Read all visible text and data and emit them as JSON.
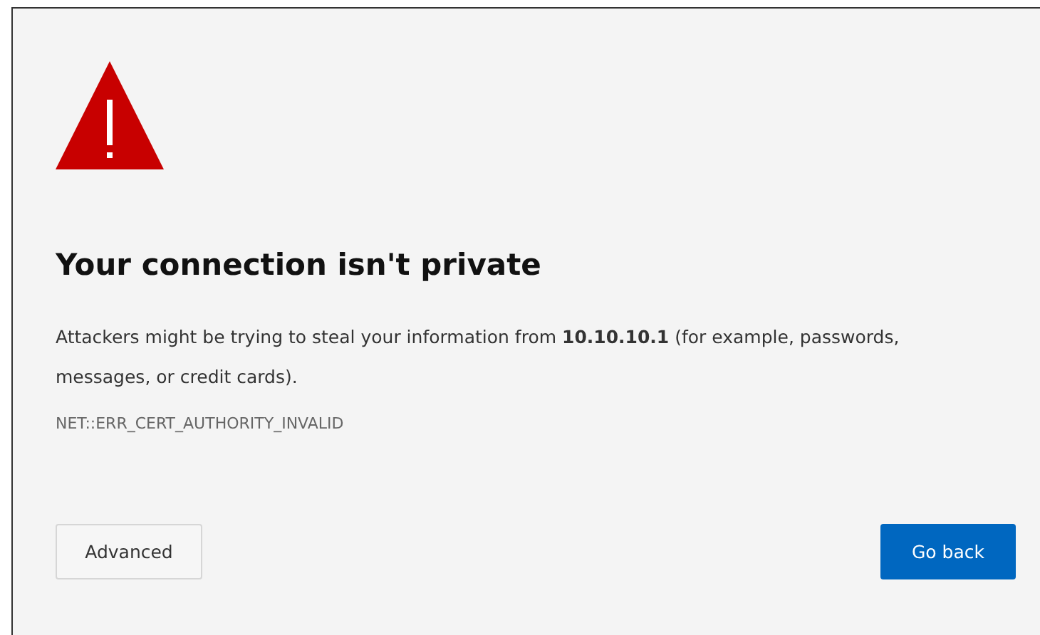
{
  "title": "Your connection isn't private",
  "message": "Attackers might be trying to steal your information from **10.10.10.1** (for example, passwords, messages, or credit cards).",
  "error_code": "NET::ERR_CERT_AUTHORITY_INVALID",
  "buttons": [
    {
      "label": "Advanced",
      "kind": "secondary"
    },
    {
      "label": "Go back",
      "kind": "primary"
    }
  ]
}
